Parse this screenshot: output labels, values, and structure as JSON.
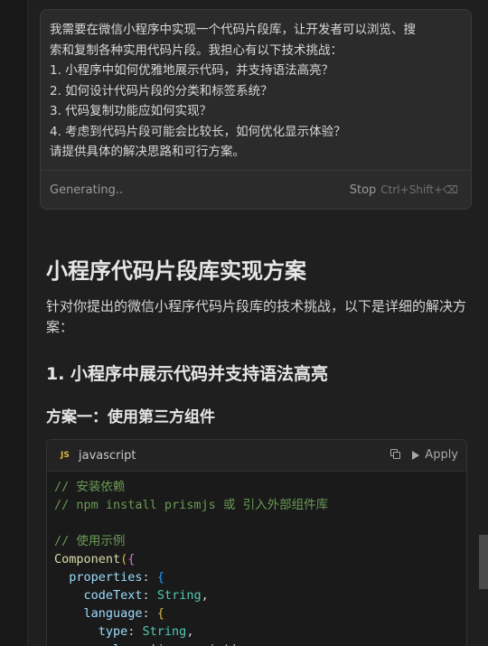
{
  "prompt": {
    "lines": [
      "我需要在微信小程序中实现一个代码片段库，让开发者可以浏览、搜",
      "索和复制各种实用代码片段。我担心有以下技术挑战：",
      "1. 小程序中如何优雅地展示代码，并支持语法高亮？",
      "2. 如何设计代码片段的分类和标签系统？",
      "3. 代码复制功能应如何实现？",
      "4. 考虑到代码片段可能会比较长，如何优化显示体验？",
      "请提供具体的解决思路和可行方案。"
    ],
    "status": "Generating..",
    "stop_label": "Stop",
    "stop_shortcut": "Ctrl+Shift+⌫"
  },
  "response": {
    "title": "小程序代码片段库实现方案",
    "intro": "针对你提出的微信小程序代码片段库的技术挑战，以下是详细的解决方案：",
    "section1": "1. 小程序中展示代码并支持语法高亮",
    "subsection1": "方案一：使用第三方组件"
  },
  "code_block": {
    "language": "javascript",
    "language_badge": "JS",
    "apply_label": "Apply",
    "lines": [
      [
        {
          "t": "// 安装依赖",
          "c": "comment"
        }
      ],
      [
        {
          "t": "// npm install prismjs 或 引入外部组件库",
          "c": "comment"
        }
      ],
      [],
      [
        {
          "t": "// 使用示例",
          "c": "comment"
        }
      ],
      [
        {
          "t": "Component",
          "c": "fn"
        },
        {
          "t": "(",
          "c": "paren"
        },
        {
          "t": "{",
          "c": "brace"
        }
      ],
      [
        {
          "t": "  properties",
          "c": "prop"
        },
        {
          "t": ": ",
          "c": "punct"
        },
        {
          "t": "{",
          "c": "brace2"
        }
      ],
      [
        {
          "t": "    codeText",
          "c": "prop"
        },
        {
          "t": ": ",
          "c": "punct"
        },
        {
          "t": "String",
          "c": "type"
        },
        {
          "t": ",",
          "c": "punct"
        }
      ],
      [
        {
          "t": "    language",
          "c": "prop"
        },
        {
          "t": ": ",
          "c": "punct"
        },
        {
          "t": "{",
          "c": "paren"
        }
      ],
      [
        {
          "t": "      type",
          "c": "prop"
        },
        {
          "t": ": ",
          "c": "punct"
        },
        {
          "t": "String",
          "c": "type"
        },
        {
          "t": ",",
          "c": "punct"
        }
      ],
      [
        {
          "t": "      value",
          "c": "prop"
        },
        {
          "t": ": ",
          "c": "punct"
        },
        {
          "t": "'javascript'",
          "c": "punct"
        }
      ]
    ]
  },
  "colors": {
    "background": "#1f1f1f",
    "card": "#2b2b2b",
    "comment": "#6a9955",
    "keyword_fn": "#dcdcaa",
    "property": "#9cdcfe",
    "type": "#4ec9b0"
  }
}
